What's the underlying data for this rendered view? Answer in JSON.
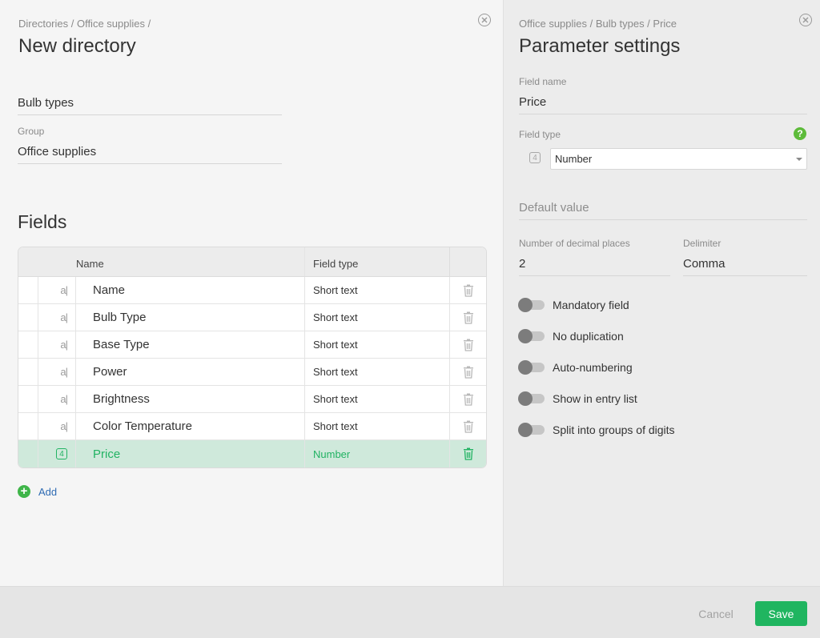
{
  "left": {
    "breadcrumb": "Directories / Office supplies /",
    "title": "New directory",
    "name_value": "Bulb types",
    "group_label": "Group",
    "group_value": "Office supplies",
    "fields_title": "Fields",
    "table": {
      "headers": {
        "name": "Name",
        "type": "Field type"
      },
      "rows": [
        {
          "name": "Name",
          "type": "Short text",
          "icon": "text-field-icon",
          "icon_glyph": "a|"
        },
        {
          "name": "Bulb Type",
          "type": "Short text",
          "icon": "text-field-icon",
          "icon_glyph": "a|"
        },
        {
          "name": "Base Type",
          "type": "Short text",
          "icon": "text-field-icon",
          "icon_glyph": "a|"
        },
        {
          "name": "Power",
          "type": "Short text",
          "icon": "text-field-icon",
          "icon_glyph": "a|"
        },
        {
          "name": "Brightness",
          "type": "Short text",
          "icon": "text-field-icon",
          "icon_glyph": "a|"
        },
        {
          "name": "Color Temperature",
          "type": "Short text",
          "icon": "text-field-icon",
          "icon_glyph": "a|"
        },
        {
          "name": "Price",
          "type": "Number",
          "icon": "number-field-icon",
          "icon_glyph": "4",
          "selected": true
        }
      ]
    },
    "add_label": "Add"
  },
  "right": {
    "breadcrumb": "Office supplies / Bulb types / Price",
    "title": "Parameter settings",
    "field_name_label": "Field name",
    "field_name_value": "Price",
    "field_type_label": "Field type",
    "field_type_badge": "4",
    "field_type_value": "Number",
    "default_value_placeholder": "Default value",
    "decimal_label": "Number of decimal places",
    "decimal_value": "2",
    "delimiter_label": "Delimiter",
    "delimiter_value": "Comma",
    "toggles": [
      {
        "label": "Mandatory field",
        "on": false
      },
      {
        "label": "No duplication",
        "on": false
      },
      {
        "label": "Auto-numbering",
        "on": false
      },
      {
        "label": "Show in entry list",
        "on": false
      },
      {
        "label": "Split into groups of digits",
        "on": false
      }
    ]
  },
  "footer": {
    "cancel_label": "Cancel",
    "save_label": "Save"
  },
  "colors": {
    "accent_green": "#20b560",
    "selected_row_bg": "#cfe9db",
    "link_blue": "#2e6bb3"
  }
}
